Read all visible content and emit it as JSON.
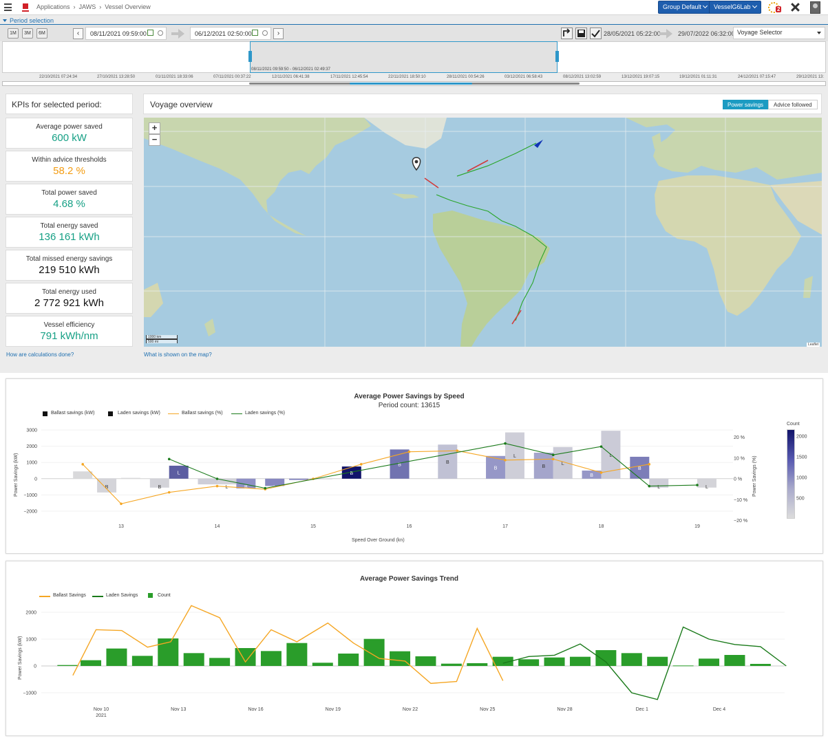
{
  "colors": {
    "accent": "#1e5eae",
    "teal": "#16a085",
    "orange": "#f39c12",
    "green": "#2a9d2a",
    "navy": "#11146a",
    "laden_line": "#1a7a1a",
    "ballast_line": "#f5a623"
  },
  "topbar": {
    "breadcrumb": [
      "Applications",
      "JAWS",
      "Vessel Overview"
    ],
    "group_btn": "Group Default",
    "vessel_btn": "VesselG6Lab",
    "notif_count": "2"
  },
  "period": {
    "label": "Period selection",
    "quick": [
      "1M",
      "3M",
      "6M"
    ],
    "start": "08/11/2021 09:59:00",
    "end": "06/12/2021 02:50:00",
    "range_start": "28/05/2021 05:22:00",
    "range_end": "29/07/2022 06:32:00",
    "voyage_selector": "Voyage Selector",
    "selection_text": "08/11/2021 09:59:50 - 06/12/2021 02:49:37",
    "ticks": [
      "22/10/2021 07:24:34",
      "27/10/2021 13:28:50",
      "01/11/2021 18:33:06",
      "07/11/2021 00:37:22",
      "12/11/2021 06:41:38",
      "17/11/2021 12:45:54",
      "22/11/2021 18:50:10",
      "28/11/2021 00:54:26",
      "03/12/2021 06:58:43",
      "08/12/2021 13:02:59",
      "13/12/2021 19:07:15",
      "19/12/2021 01:11:31",
      "24/12/2021 07:15:47",
      "29/12/2021 13:"
    ]
  },
  "kpis": {
    "title": "KPIs for selected period:",
    "items": [
      {
        "label": "Average power saved",
        "value": "600 kW",
        "color": "#16a085"
      },
      {
        "label": "Within advice thresholds",
        "value": "58.2 %",
        "color": "#f39c12"
      },
      {
        "label": "Total power saved",
        "value": "4.68 %",
        "color": "#16a085"
      },
      {
        "label": "Total energy saved",
        "value": "136 161 kWh",
        "color": "#16a085"
      },
      {
        "label": "Total missed energy savings",
        "value": "219 510 kWh",
        "color": "#111111"
      },
      {
        "label": "Total energy used",
        "value": "2 772 921 kWh",
        "color": "#111111"
      },
      {
        "label": "Vessel efficiency",
        "value": "791 kWh/nm",
        "color": "#16a085"
      }
    ],
    "link": "How are calculations done?"
  },
  "voyage": {
    "title": "Voyage overview",
    "toggle": [
      "Power savings",
      "Advice followed"
    ],
    "map_link": "What is shown on the map?",
    "zoom_in": "+",
    "zoom_out": "−",
    "scale_text": [
      "1000 km",
      "500 mi"
    ],
    "attribution": "Leaflet"
  },
  "chart_data": [
    {
      "type": "bar",
      "title": "Average Power Savings by Speed",
      "subtitle": "Period count: 13615",
      "xlabel": "Speed Over Ground (kn)",
      "ylabel": "Power Savings (kW)",
      "y2label": "Power Savings (%)",
      "colorbar_label": "Count",
      "ylim": [
        -2500,
        3300
      ],
      "y2lim": [
        -0.2,
        0.22
      ],
      "x_ticks": [
        13,
        14,
        15,
        16,
        17,
        18,
        19
      ],
      "y_ticks": [
        3000,
        2000,
        1000,
        0,
        -1000,
        -2000
      ],
      "y_tick_labels": [
        "3000",
        "2000",
        "1000",
        "0",
        "−1000",
        "−2000"
      ],
      "y2_ticks": [
        0.2,
        0.1,
        0,
        -0.1,
        -0.2
      ],
      "y2_tick_labels": [
        "20 %",
        "10 %",
        "0 %",
        "−10 %",
        "−20 %"
      ],
      "colorbar_ticks": [
        2000,
        1500,
        1000,
        500
      ],
      "colorbar_tick_labels": [
        "2000",
        "1500",
        "1000",
        "500"
      ],
      "legend": [
        "Ballast savings (kW)",
        "Laden savings (kW)",
        "Ballast savings (%)",
        "Laden savings (%)"
      ],
      "ballast_bars": [
        {
          "x": 12.6,
          "y": 450,
          "count": 50,
          "label": ""
        },
        {
          "x": 12.85,
          "y": -850,
          "count": 120,
          "label": "B"
        },
        {
          "x": 13.4,
          "y": -550,
          "count": 130,
          "label": "B"
        },
        {
          "x": 13.9,
          "y": -350,
          "count": 200,
          "label": ""
        },
        {
          "x": 14.3,
          "y": -600,
          "count": 1100,
          "label": "B"
        },
        {
          "x": 14.85,
          "y": -80,
          "count": 1200,
          "label": "B"
        },
        {
          "x": 15.4,
          "y": 750,
          "count": 2300,
          "label": "B"
        },
        {
          "x": 15.9,
          "y": 1800,
          "count": 1400,
          "label": "B"
        },
        {
          "x": 16.4,
          "y": 2100,
          "count": 400,
          "label": "B"
        },
        {
          "x": 16.9,
          "y": 1400,
          "count": 1000,
          "label": "B"
        },
        {
          "x": 17.4,
          "y": 1600,
          "count": 800,
          "label": "B"
        },
        {
          "x": 17.9,
          "y": 500,
          "count": 1000,
          "label": "B"
        },
        {
          "x": 18.4,
          "y": 1350,
          "count": 1300,
          "label": "B"
        }
      ],
      "laden_bars": [
        {
          "x": 13.1,
          "y": 50,
          "count": 50,
          "label": ""
        },
        {
          "x": 13.6,
          "y": 800,
          "count": 1600,
          "label": "L"
        },
        {
          "x": 14.1,
          "y": -350,
          "count": 150,
          "label": "L"
        },
        {
          "x": 14.6,
          "y": -450,
          "count": 1200,
          "label": "L"
        },
        {
          "x": 15.1,
          "y": 0,
          "count": 50,
          "label": ""
        },
        {
          "x": 17.1,
          "y": 2850,
          "count": 200,
          "label": "L"
        },
        {
          "x": 17.6,
          "y": 1950,
          "count": 250,
          "label": "L"
        },
        {
          "x": 18.1,
          "y": 2950,
          "count": 250,
          "label": "L"
        },
        {
          "x": 18.6,
          "y": -550,
          "count": 200,
          "label": "L"
        },
        {
          "x": 19.1,
          "y": -550,
          "count": 120,
          "label": "L"
        }
      ],
      "ballast_pct": [
        {
          "x": 12.6,
          "y": 0.07
        },
        {
          "x": 13.0,
          "y": -0.12
        },
        {
          "x": 13.5,
          "y": -0.065
        },
        {
          "x": 14.0,
          "y": -0.035
        },
        {
          "x": 14.5,
          "y": -0.05
        },
        {
          "x": 15.0,
          "y": 0.0
        },
        {
          "x": 15.5,
          "y": 0.07
        },
        {
          "x": 16.0,
          "y": 0.13
        },
        {
          "x": 16.5,
          "y": 0.135
        },
        {
          "x": 17.0,
          "y": 0.09
        },
        {
          "x": 17.5,
          "y": 0.095
        },
        {
          "x": 18.0,
          "y": 0.03
        },
        {
          "x": 18.5,
          "y": 0.07
        }
      ],
      "laden_pct": [
        {
          "x": 13.5,
          "y": 0.095
        },
        {
          "x": 14.0,
          "y": 0.0
        },
        {
          "x": 14.5,
          "y": -0.045
        },
        {
          "x": 17.0,
          "y": 0.17
        },
        {
          "x": 17.5,
          "y": 0.115
        },
        {
          "x": 18.0,
          "y": 0.155
        },
        {
          "x": 18.5,
          "y": -0.035
        },
        {
          "x": 19.0,
          "y": -0.03
        }
      ]
    },
    {
      "type": "bar",
      "title": "Average Power Savings Trend",
      "ylabel": "Power Savings (kW)",
      "ylim": [
        -1200,
        2700
      ],
      "y_ticks": [
        2000,
        1000,
        0,
        -1000
      ],
      "y_tick_labels": [
        "2000",
        "1000",
        "0",
        "−1000"
      ],
      "x_ticks": [
        {
          "day": 10,
          "label": "Nov 10",
          "sub": "2021"
        },
        {
          "day": 13,
          "label": "Nov 13",
          "sub": ""
        },
        {
          "day": 16,
          "label": "Nov 16",
          "sub": ""
        },
        {
          "day": 19,
          "label": "Nov 19",
          "sub": ""
        },
        {
          "day": 22,
          "label": "Nov 22",
          "sub": ""
        },
        {
          "day": 25,
          "label": "Nov 25",
          "sub": ""
        },
        {
          "day": 28,
          "label": "Nov 28",
          "sub": ""
        },
        {
          "day": 31,
          "label": "Dec 1",
          "sub": ""
        },
        {
          "day": 34,
          "label": "Dec 4",
          "sub": ""
        }
      ],
      "legend": [
        "Ballast Savings",
        "Laden Savings",
        "Count"
      ],
      "day_start": 8.5,
      "day_end": 36.5,
      "count": [
        {
          "d": 8.7,
          "v": 40
        },
        {
          "d": 9.6,
          "v": 250
        },
        {
          "d": 10.6,
          "v": 760
        },
        {
          "d": 11.6,
          "v": 440
        },
        {
          "d": 12.6,
          "v": 1200
        },
        {
          "d": 13.6,
          "v": 560
        },
        {
          "d": 14.6,
          "v": 350
        },
        {
          "d": 15.6,
          "v": 780
        },
        {
          "d": 16.6,
          "v": 650
        },
        {
          "d": 17.6,
          "v": 1000
        },
        {
          "d": 18.6,
          "v": 140
        },
        {
          "d": 19.6,
          "v": 540
        },
        {
          "d": 20.6,
          "v": 1180
        },
        {
          "d": 21.6,
          "v": 640
        },
        {
          "d": 22.6,
          "v": 420
        },
        {
          "d": 23.6,
          "v": 100
        },
        {
          "d": 24.6,
          "v": 120
        },
        {
          "d": 25.6,
          "v": 400
        },
        {
          "d": 26.6,
          "v": 290
        },
        {
          "d": 27.6,
          "v": 370
        },
        {
          "d": 28.6,
          "v": 400
        },
        {
          "d": 29.6,
          "v": 690
        },
        {
          "d": 30.6,
          "v": 560
        },
        {
          "d": 31.6,
          "v": 400
        },
        {
          "d": 32.6,
          "v": 20
        },
        {
          "d": 33.6,
          "v": 320
        },
        {
          "d": 34.6,
          "v": 480
        },
        {
          "d": 35.6,
          "v": 90
        }
      ],
      "ballast": [
        {
          "d": 8.9,
          "v": -350
        },
        {
          "d": 9.8,
          "v": 1350
        },
        {
          "d": 10.8,
          "v": 1320
        },
        {
          "d": 11.8,
          "v": 700
        },
        {
          "d": 12.7,
          "v": 900
        },
        {
          "d": 13.5,
          "v": 2250
        },
        {
          "d": 14.6,
          "v": 1800
        },
        {
          "d": 15.6,
          "v": 150
        },
        {
          "d": 16.6,
          "v": 1350
        },
        {
          "d": 17.6,
          "v": 900
        },
        {
          "d": 18.8,
          "v": 1600
        },
        {
          "d": 19.8,
          "v": 850
        },
        {
          "d": 20.8,
          "v": 280
        },
        {
          "d": 21.8,
          "v": 180
        },
        {
          "d": 22.8,
          "v": -650
        },
        {
          "d": 23.8,
          "v": -580
        },
        {
          "d": 24.6,
          "v": 1400
        },
        {
          "d": 25.6,
          "v": -550
        }
      ],
      "laden": [
        {
          "d": 25.6,
          "v": 100
        },
        {
          "d": 26.6,
          "v": 350
        },
        {
          "d": 27.6,
          "v": 400
        },
        {
          "d": 28.6,
          "v": 820
        },
        {
          "d": 29.6,
          "v": 150
        },
        {
          "d": 30.6,
          "v": -1000
        },
        {
          "d": 31.6,
          "v": -1250
        },
        {
          "d": 32.6,
          "v": 1450
        },
        {
          "d": 33.6,
          "v": 1000
        },
        {
          "d": 34.6,
          "v": 800
        },
        {
          "d": 35.6,
          "v": 720
        },
        {
          "d": 36.6,
          "v": 0
        }
      ]
    }
  ]
}
